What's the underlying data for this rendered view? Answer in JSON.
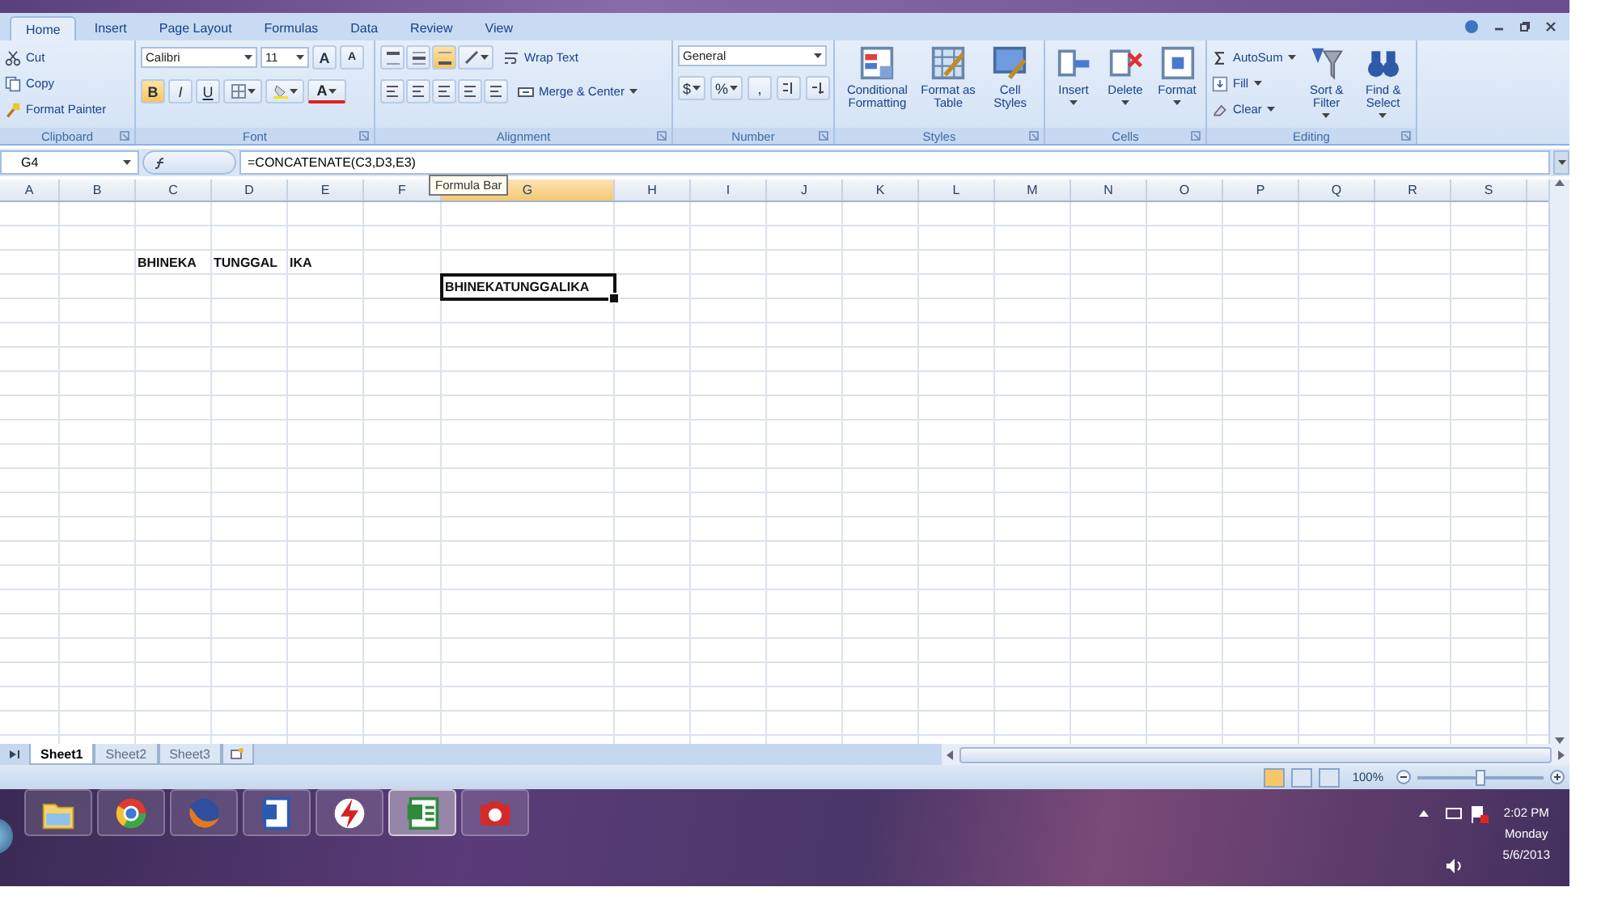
{
  "tabs": [
    {
      "label": "Home",
      "selected": true
    },
    {
      "label": "Insert",
      "selected": false
    },
    {
      "label": "Page Layout",
      "selected": false
    },
    {
      "label": "Formulas",
      "selected": false
    },
    {
      "label": "Data",
      "selected": false
    },
    {
      "label": "Review",
      "selected": false
    },
    {
      "label": "View",
      "selected": false
    }
  ],
  "clipboard": {
    "title": "Clipboard",
    "commands": [
      {
        "kind": "cut",
        "label": "Cut"
      },
      {
        "kind": "copy",
        "label": "Copy"
      },
      {
        "kind": "brush",
        "label": "Format Painter"
      }
    ]
  },
  "font": {
    "title": "Font",
    "name": "Calibri",
    "size": "11",
    "grow": "A",
    "shrink": "A",
    "color_label": "A",
    "styles": [
      {
        "kind": "bold",
        "label": "B",
        "on": true
      },
      {
        "kind": "italic",
        "label": "I",
        "on": false
      },
      {
        "kind": "underline",
        "label": "U",
        "on": false
      }
    ]
  },
  "alignment": {
    "title": "Alignment",
    "vertical": [
      {
        "selected": false
      },
      {
        "selected": false
      },
      {
        "selected": true
      }
    ],
    "wrap": "Wrap Text",
    "merge": "Merge & Center"
  },
  "number": {
    "title": "Number",
    "format": "General",
    "symbols": [
      "$",
      "%",
      ","
    ]
  },
  "styles": {
    "title": "Styles",
    "commands": [
      {
        "kind": "conditional",
        "label": "Conditional Formatting"
      },
      {
        "kind": "table",
        "label": "Format as Table"
      },
      {
        "kind": "cellstyles",
        "label": "Cell Styles"
      }
    ]
  },
  "cells": {
    "title": "Cells",
    "commands": [
      {
        "kind": "insert",
        "label": "Insert"
      },
      {
        "kind": "delete",
        "label": "Delete"
      },
      {
        "kind": "format",
        "label": "Format"
      }
    ]
  },
  "editing": {
    "title": "Editing",
    "small": [
      {
        "kind": "sum",
        "label": "AutoSum"
      },
      {
        "kind": "fill",
        "label": "Fill"
      },
      {
        "kind": "clear",
        "label": "Clear"
      }
    ],
    "large": [
      {
        "kind": "sort",
        "label": "Sort & Filter"
      },
      {
        "kind": "find",
        "label": "Find & Select"
      }
    ]
  },
  "formula_bar": {
    "name_box": "G4",
    "formula": "=CONCATENATE(C3,D3,E3)",
    "tooltip": "Formula Bar"
  },
  "sheet": {
    "columns": [
      {
        "label": "A",
        "selected": false
      },
      {
        "label": "B",
        "selected": false
      },
      {
        "label": "C",
        "selected": false
      },
      {
        "label": "D",
        "selected": false
      },
      {
        "label": "E",
        "selected": false
      },
      {
        "label": "F",
        "selected": false
      },
      {
        "label": "G",
        "selected": true
      },
      {
        "label": "H",
        "selected": false
      },
      {
        "label": "I",
        "selected": false
      },
      {
        "label": "J",
        "selected": false
      },
      {
        "label": "K",
        "selected": false
      },
      {
        "label": "L",
        "selected": false
      },
      {
        "label": "M",
        "selected": false
      },
      {
        "label": "N",
        "selected": false
      },
      {
        "label": "O",
        "selected": false
      },
      {
        "label": "P",
        "selected": false
      },
      {
        "label": "Q",
        "selected": false
      },
      {
        "label": "R",
        "selected": false
      },
      {
        "label": "S",
        "selected": false
      }
    ],
    "rows": [
      {
        "cells": [
          null
        ]
      },
      {
        "cells": [
          null
        ]
      },
      {
        "cells": [
          null,
          null,
          {
            "text": "BHINEKA",
            "selected": false
          },
          {
            "text": "TUNGGAL",
            "selected": false
          },
          {
            "text": "IKA",
            "selected": false
          }
        ]
      },
      {
        "cells": [
          null,
          null,
          null,
          null,
          null,
          null,
          {
            "text": "BHINEKATUNGGALIKA",
            "selected": true
          }
        ]
      }
    ]
  },
  "sheet_tabs": [
    {
      "label": "Sheet1",
      "selected": true
    },
    {
      "label": "Sheet2",
      "selected": false
    },
    {
      "label": "Sheet3",
      "selected": false
    }
  ],
  "status": {
    "views": [
      {
        "selected": true
      },
      {
        "selected": false
      },
      {
        "selected": false
      }
    ],
    "zoom": "100%",
    "zoom_slider": {
      "level": 0.5
    }
  },
  "taskbar": {
    "apps": [
      {
        "kind": "folder",
        "selected": false
      },
      {
        "kind": "ring",
        "selected": false
      },
      {
        "kind": "orb",
        "selected": false
      },
      {
        "kind": "document",
        "selected": false
      },
      {
        "kind": "bolt",
        "selected": false
      },
      {
        "kind": "spreadsheet",
        "selected": true
      },
      {
        "kind": "camera",
        "selected": false
      }
    ],
    "clock": {
      "time": "2:02 PM",
      "day": "Monday",
      "date": "5/6/2013"
    }
  }
}
